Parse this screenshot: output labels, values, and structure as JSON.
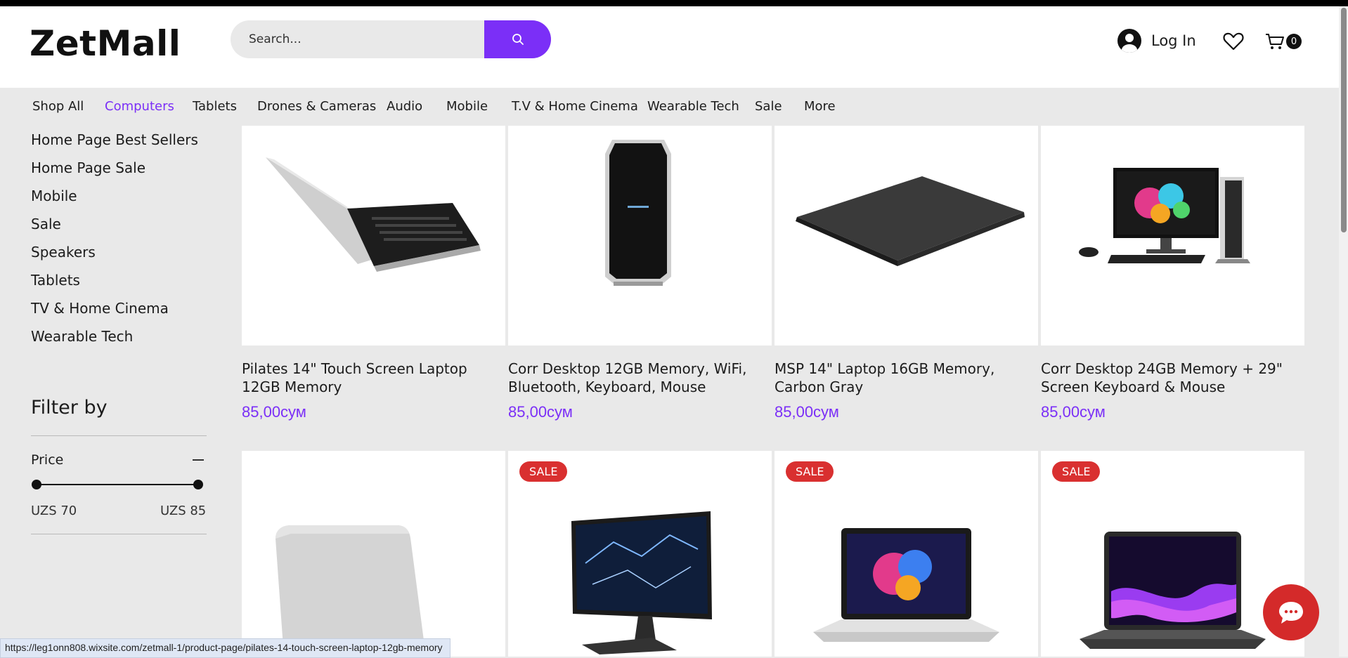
{
  "header": {
    "logo": "ZetMall",
    "search_placeholder": "Search...",
    "login_label": "Log In",
    "cart_count": "0"
  },
  "nav": {
    "items": [
      {
        "label": "Shop All"
      },
      {
        "label": "Computers",
        "active": true
      },
      {
        "label": "Tablets"
      },
      {
        "label": "Drones & Cameras"
      },
      {
        "label": "Audio"
      },
      {
        "label": "Mobile"
      },
      {
        "label": "T.V & Home Cinema"
      },
      {
        "label": "Wearable Tech"
      },
      {
        "label": "Sale"
      },
      {
        "label": "More"
      }
    ]
  },
  "sidebar": {
    "categories": [
      "Home Page Best Sellers",
      "Home Page Sale",
      "Mobile",
      "Sale",
      "Speakers",
      "Tablets",
      "TV & Home Cinema",
      "Wearable Tech"
    ],
    "filter_title": "Filter by",
    "price_label": "Price",
    "price_min": "UZS 70",
    "price_max": "UZS 85"
  },
  "products": [
    {
      "title": "Pilates 14\" Touch Screen Laptop 12GB Memory",
      "price": "85,00сум",
      "sale": false,
      "icon": "laptop-keyboard-icon"
    },
    {
      "title": "Corr Desktop 12GB Memory, WiFi, Bluetooth, Keyboard, Mouse",
      "price": "85,00сум",
      "sale": false,
      "icon": "desktop-tower-icon"
    },
    {
      "title": "MSP 14\" Laptop 16GB Memory, Carbon Gray",
      "price": "85,00сум",
      "sale": false,
      "icon": "closed-laptop-icon"
    },
    {
      "title": "Corr Desktop 24GB Memory + 29\" Screen Keyboard & Mouse",
      "price": "85,00сум",
      "sale": false,
      "icon": "desktop-set-icon"
    },
    {
      "title": "",
      "price": "",
      "sale": false,
      "icon": "white-laptop-icon"
    },
    {
      "title": "",
      "price": "",
      "sale": true,
      "icon": "monitor-icon"
    },
    {
      "title": "",
      "price": "",
      "sale": true,
      "icon": "open-laptop-icon"
    },
    {
      "title": "",
      "price": "",
      "sale": true,
      "icon": "dark-laptop-icon"
    }
  ],
  "sale_badge": "SALE",
  "status_url": "https://leg1onn808.wixsite.com/zetmall-1/product-page/pilates-14-touch-screen-laptop-12gb-memory",
  "colors": {
    "accent": "#7b2ff7",
    "sale": "#d93030",
    "chat": "#d42a2a"
  }
}
